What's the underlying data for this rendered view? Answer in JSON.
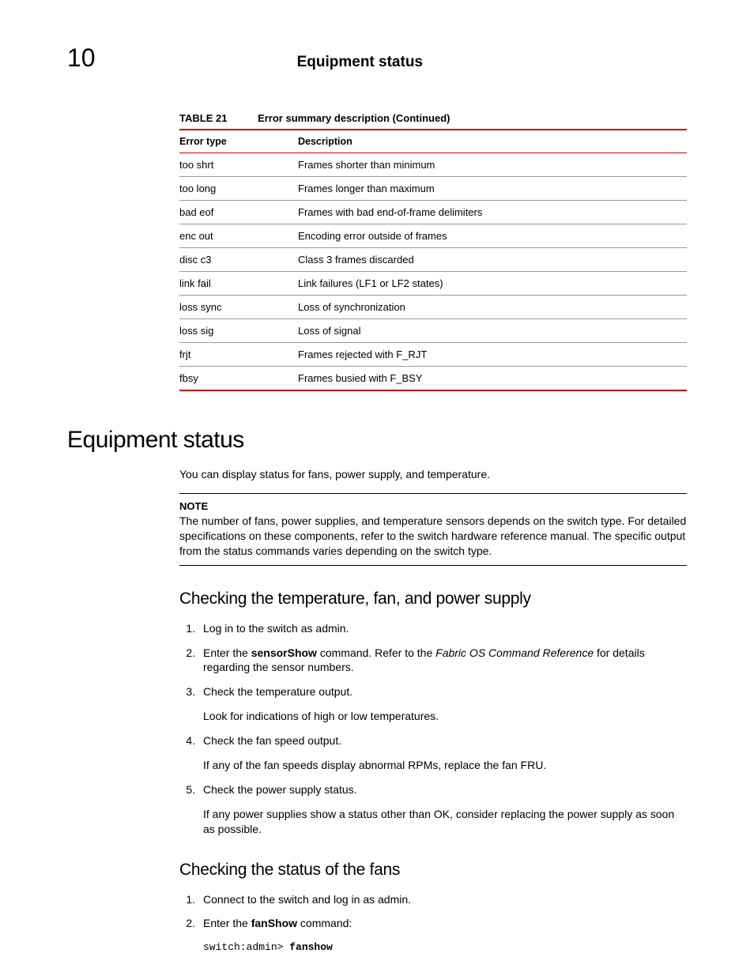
{
  "header": {
    "chapter_number": "10",
    "title": "Equipment status"
  },
  "table": {
    "label": "TABLE 21",
    "title": "Error summary description (Continued)",
    "headers": {
      "col1": "Error type",
      "col2": "Description"
    },
    "rows": [
      {
        "type": "too shrt",
        "desc": "Frames shorter than minimum"
      },
      {
        "type": "too long",
        "desc": "Frames longer than maximum"
      },
      {
        "type": "bad eof",
        "desc": "Frames with bad end-of-frame delimiters"
      },
      {
        "type": "enc out",
        "desc": "Encoding error outside of frames"
      },
      {
        "type": "disc c3",
        "desc": "Class 3 frames discarded"
      },
      {
        "type": "link fail",
        "desc": "Link failures (LF1 or LF2 states)"
      },
      {
        "type": "loss sync",
        "desc": "Loss of synchronization"
      },
      {
        "type": "loss sig",
        "desc": "Loss of signal"
      },
      {
        "type": "frjt",
        "desc": "Frames rejected with F_RJT"
      },
      {
        "type": "fbsy",
        "desc": "Frames busied with F_BSY"
      }
    ]
  },
  "section1": {
    "heading": "Equipment status",
    "intro": "You can display status for fans, power supply, and temperature.",
    "note_label": "NOTE",
    "note_text": "The number of fans, power supplies, and temperature sensors depends on the switch type. For detailed specifications on these components, refer to the switch hardware reference manual. The specific output from the status commands varies depending on the switch type."
  },
  "section2": {
    "heading": "Checking the temperature, fan, and power supply",
    "steps": {
      "s1": "Log in to the switch as admin.",
      "s2_pre": "Enter the ",
      "s2_cmd": "sensorShow",
      "s2_mid": " command. Refer to the ",
      "s2_ref": "Fabric OS Command Reference",
      "s2_post": " for details regarding the sensor numbers.",
      "s3": "Check the temperature output.",
      "s3_sub": "Look for indications of high or low temperatures.",
      "s4": "Check the fan speed output.",
      "s4_sub": "If any of the fan speeds display abnormal RPMs, replace the fan FRU.",
      "s5": "Check the power supply status.",
      "s5_sub": "If any power supplies show a status other than OK, consider replacing the power supply as soon as possible."
    }
  },
  "section3": {
    "heading": "Checking the status of the fans",
    "steps": {
      "s1": "Connect to the switch and log in as admin.",
      "s2_pre": "Enter the ",
      "s2_cmd": "fanShow",
      "s2_post": " command:",
      "code_prompt": "switch:admin> ",
      "code_cmd": "fanshow"
    }
  }
}
